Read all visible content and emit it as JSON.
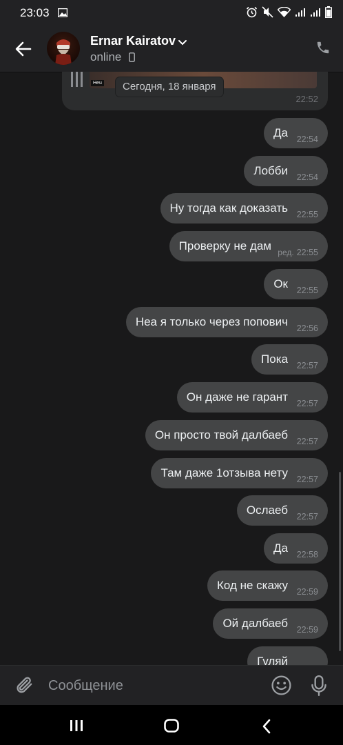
{
  "status_bar": {
    "time": "23:03"
  },
  "header": {
    "name": "Ernar Kairatov",
    "status": "online"
  },
  "date_pill": "Сегодня, 18 января",
  "previous_card": {
    "time": "22:52",
    "logo_text": "Heu"
  },
  "messages": [
    {
      "text": "Да",
      "time": "22:54"
    },
    {
      "text": "Лобби",
      "time": "22:54"
    },
    {
      "text": "Ну тогда как доказать",
      "time": "22:55"
    },
    {
      "text": "Проверку не дам",
      "time": "22:55",
      "edited": "ред."
    },
    {
      "text": "Ок",
      "time": "22:55"
    },
    {
      "text": "Неа я только через попович",
      "time": "22:56"
    },
    {
      "text": "Пока",
      "time": "22:57"
    },
    {
      "text": "Он даже не гарант",
      "time": "22:57"
    },
    {
      "text": "Он просто твой далбаеб",
      "time": "22:57"
    },
    {
      "text": "Там даже 1отзыва нету",
      "time": "22:57"
    },
    {
      "text": "Ослаеб",
      "time": "22:57"
    },
    {
      "text": "Да",
      "time": "22:58"
    },
    {
      "text": "Код не скажу",
      "time": "22:59"
    },
    {
      "text": "Ой далбаеб",
      "time": "22:59"
    },
    {
      "text": "Гуляй",
      "time": ""
    }
  ],
  "composer": {
    "placeholder": "Сообщение"
  },
  "colors": {
    "bubble": "#444546",
    "background": "#19191a",
    "bar": "#222224"
  },
  "icons": [
    "back-arrow-icon",
    "phone-icon",
    "chevron-down-icon",
    "attach-icon",
    "emoji-icon",
    "mic-icon",
    "recent-apps-icon",
    "home-icon",
    "nav-back-icon"
  ]
}
